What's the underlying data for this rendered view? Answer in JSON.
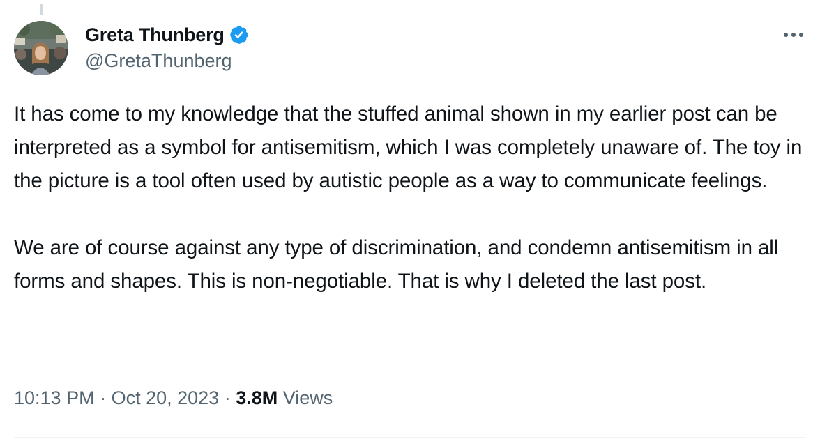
{
  "author": {
    "display_name": "Greta Thunberg",
    "handle": "@GretaThunberg",
    "verified": true,
    "verified_color": "#1d9bf0"
  },
  "icons": {
    "verified": "verified-badge-icon",
    "more": "more-options-icon",
    "avatar": "profile-photo"
  },
  "tweet": {
    "paragraphs": [
      "It has come to my knowledge that the stuffed animal shown in my earlier post can be interpreted as a symbol for antisemitism, which I was completely unaware of. The toy in the picture is a tool often used by autistic people as a way to communicate feelings.",
      "We are of course against any type of discrimination, and condemn antisemitism in all forms and shapes. This is non-negotiable. That is why I deleted the last post."
    ]
  },
  "meta": {
    "time": "10:13 PM",
    "separator_1": " · ",
    "date": "Oct 20, 2023",
    "separator_2": " · ",
    "views_count": "3.8M",
    "views_label": " Views"
  },
  "colors": {
    "text_primary": "#0f1419",
    "text_secondary": "#536471",
    "divider": "#eff3f4"
  }
}
